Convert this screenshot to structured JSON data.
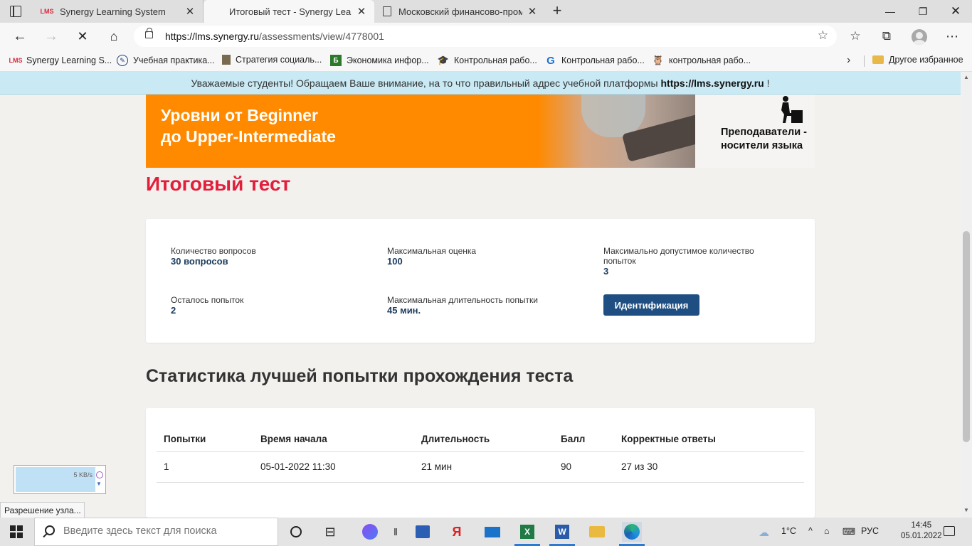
{
  "browser": {
    "tabs": [
      {
        "favicon": "LMS",
        "title": "Synergy Learning System",
        "active": false
      },
      {
        "favicon": "",
        "title": "Итоговый тест - Synergy Learning",
        "active": true
      },
      {
        "favicon": "",
        "title": "Московский финансово-промышл",
        "active": false
      }
    ],
    "address": {
      "host": "https://lms.synergy.ru",
      "path": "/assessments/view/4778001"
    },
    "favorites": [
      {
        "label": "Synergy Learning S...",
        "icon": "lms-icon"
      },
      {
        "label": "Учебная практика...",
        "icon": "pencil-icon"
      },
      {
        "label": "Стратегия социаль...",
        "icon": "doc-icon"
      },
      {
        "label": "Экономика инфор...",
        "icon": "b-icon"
      },
      {
        "label": "Контрольная рабо...",
        "icon": "cap-icon"
      },
      {
        "label": "Контрольная рабо...",
        "icon": "c-icon"
      },
      {
        "label": "контрольная рабо...",
        "icon": "owl-icon"
      }
    ],
    "other_favorites": "Другое избранное"
  },
  "notice": {
    "text": "Уважаемые студенты! Обращаем Ваше внимание, на то что правильный адрес учебной платформы",
    "link": "https://lms.synergy.ru",
    "suffix": " !"
  },
  "banner": {
    "line1": "Уровни от Beginner",
    "line2": "до Upper-Intermediate",
    "tag1": "Преподаватели -",
    "tag2": "носители языка"
  },
  "page_title": "Итоговый тест",
  "info": {
    "questions_label": "Количество вопросов",
    "questions_value": "30 вопросов",
    "max_score_label": "Максимальная оценка",
    "max_score_value": "100",
    "max_attempts_label_1": "Максимально допустимое количество",
    "max_attempts_label_2": "попыток",
    "max_attempts_value": "3",
    "attempts_left_label": "Осталось попыток",
    "attempts_left_value": "2",
    "max_duration_label": "Максимальная длительность попытки",
    "max_duration_value": "45 мин.",
    "identify_button": "Идентификация"
  },
  "stats": {
    "title": "Статистика лучшей попытки прохождения теста",
    "headers": [
      "Попытки",
      "Время начала",
      "Длительность",
      "Балл",
      "Корректные ответы"
    ],
    "rows": [
      [
        "1",
        "05-01-2022 11:30",
        "21 мин",
        "90",
        "27 из 30"
      ]
    ]
  },
  "widget": {
    "speed": "5 KB/s",
    "status_tip": "Разрешение узла..."
  },
  "taskbar": {
    "search_placeholder": "Введите здесь текст для поиска",
    "weather": "1°C",
    "lang": "РУС",
    "time": "14:45",
    "date": "05.01.2022"
  }
}
